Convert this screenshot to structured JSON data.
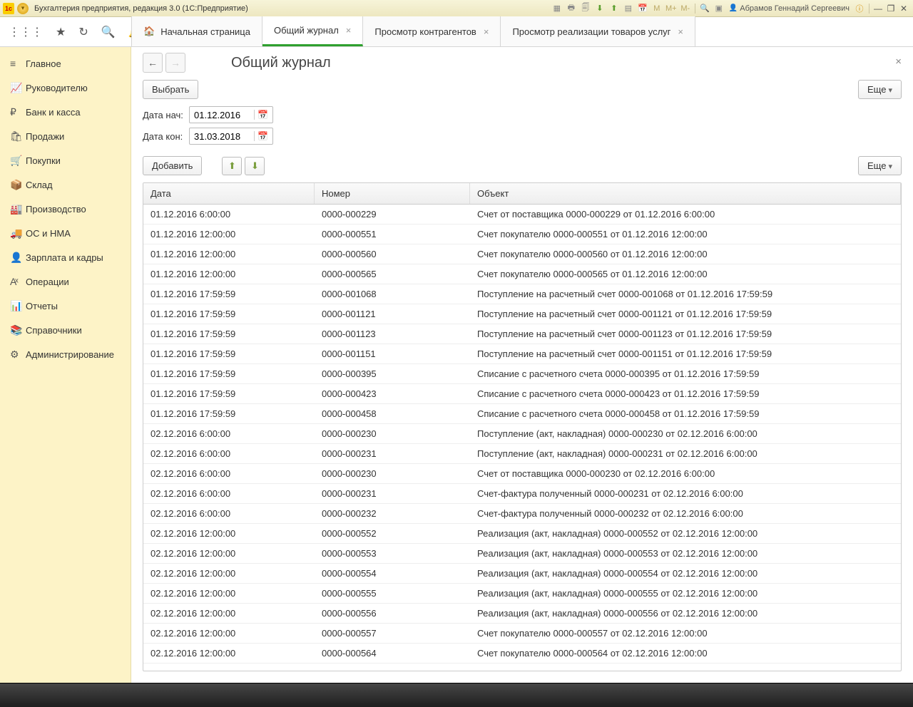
{
  "window": {
    "title": "Бухгалтерия предприятия, редакция 3.0  (1С:Предприятие)",
    "user": "Абрамов Геннадий Сергеевич"
  },
  "tabs": [
    {
      "label": "Начальная страница",
      "home": true,
      "closable": false,
      "active": false
    },
    {
      "label": "Общий журнал",
      "closable": true,
      "active": true
    },
    {
      "label": "Просмотр контрагентов",
      "closable": true,
      "active": false
    },
    {
      "label": "Просмотр реализации товаров услуг",
      "closable": true,
      "active": false
    }
  ],
  "sidebar": [
    {
      "icon": "≡",
      "label": "Главное"
    },
    {
      "icon": "📈",
      "label": "Руководителю"
    },
    {
      "icon": "₽",
      "label": "Банк и касса"
    },
    {
      "icon": "🛍",
      "label": "Продажи"
    },
    {
      "icon": "🛒",
      "label": "Покупки"
    },
    {
      "icon": "📦",
      "label": "Склад"
    },
    {
      "icon": "🏭",
      "label": "Производство"
    },
    {
      "icon": "🚚",
      "label": "ОС и НМА"
    },
    {
      "icon": "👤",
      "label": "Зарплата и кадры"
    },
    {
      "icon": "Аͯ",
      "label": "Операции"
    },
    {
      "icon": "📊",
      "label": "Отчеты"
    },
    {
      "icon": "📚",
      "label": "Справочники"
    },
    {
      "icon": "⚙",
      "label": "Администрирование"
    }
  ],
  "page": {
    "title": "Общий журнал",
    "select_btn": "Выбрать",
    "more_btn": "Еще",
    "date_from_label": "Дата нач:",
    "date_to_label": "Дата кон:",
    "date_from": "01.12.2016",
    "date_to": "31.03.2018",
    "add_btn": "Добавить"
  },
  "grid": {
    "columns": [
      "Дата",
      "Номер",
      "Объект"
    ],
    "rows": [
      {
        "d": "01.12.2016 6:00:00",
        "n": "0000-000229",
        "o": "Счет от поставщика 0000-000229 от 01.12.2016 6:00:00"
      },
      {
        "d": "01.12.2016 12:00:00",
        "n": "0000-000551",
        "o": "Счет покупателю 0000-000551 от 01.12.2016 12:00:00"
      },
      {
        "d": "01.12.2016 12:00:00",
        "n": "0000-000560",
        "o": "Счет покупателю 0000-000560 от 01.12.2016 12:00:00"
      },
      {
        "d": "01.12.2016 12:00:00",
        "n": "0000-000565",
        "o": "Счет покупателю 0000-000565 от 01.12.2016 12:00:00"
      },
      {
        "d": "01.12.2016 17:59:59",
        "n": "0000-001068",
        "o": "Поступление на расчетный счет 0000-001068 от 01.12.2016 17:59:59"
      },
      {
        "d": "01.12.2016 17:59:59",
        "n": "0000-001121",
        "o": "Поступление на расчетный счет 0000-001121 от 01.12.2016 17:59:59"
      },
      {
        "d": "01.12.2016 17:59:59",
        "n": "0000-001123",
        "o": "Поступление на расчетный счет 0000-001123 от 01.12.2016 17:59:59"
      },
      {
        "d": "01.12.2016 17:59:59",
        "n": "0000-001151",
        "o": "Поступление на расчетный счет 0000-001151 от 01.12.2016 17:59:59"
      },
      {
        "d": "01.12.2016 17:59:59",
        "n": "0000-000395",
        "o": "Списание с расчетного счета 0000-000395 от 01.12.2016 17:59:59"
      },
      {
        "d": "01.12.2016 17:59:59",
        "n": "0000-000423",
        "o": "Списание с расчетного счета 0000-000423 от 01.12.2016 17:59:59"
      },
      {
        "d": "01.12.2016 17:59:59",
        "n": "0000-000458",
        "o": "Списание с расчетного счета 0000-000458 от 01.12.2016 17:59:59"
      },
      {
        "d": "02.12.2016 6:00:00",
        "n": "0000-000230",
        "o": "Поступление (акт, накладная) 0000-000230 от 02.12.2016 6:00:00"
      },
      {
        "d": "02.12.2016 6:00:00",
        "n": "0000-000231",
        "o": "Поступление (акт, накладная) 0000-000231 от 02.12.2016 6:00:00"
      },
      {
        "d": "02.12.2016 6:00:00",
        "n": "0000-000230",
        "o": "Счет от поставщика 0000-000230 от 02.12.2016 6:00:00"
      },
      {
        "d": "02.12.2016 6:00:00",
        "n": "0000-000231",
        "o": "Счет-фактура полученный 0000-000231 от 02.12.2016 6:00:00"
      },
      {
        "d": "02.12.2016 6:00:00",
        "n": "0000-000232",
        "o": "Счет-фактура полученный 0000-000232 от 02.12.2016 6:00:00"
      },
      {
        "d": "02.12.2016 12:00:00",
        "n": "0000-000552",
        "o": "Реализация (акт, накладная) 0000-000552 от 02.12.2016 12:00:00"
      },
      {
        "d": "02.12.2016 12:00:00",
        "n": "0000-000553",
        "o": "Реализация (акт, накладная) 0000-000553 от 02.12.2016 12:00:00"
      },
      {
        "d": "02.12.2016 12:00:00",
        "n": "0000-000554",
        "o": "Реализация (акт, накладная) 0000-000554 от 02.12.2016 12:00:00"
      },
      {
        "d": "02.12.2016 12:00:00",
        "n": "0000-000555",
        "o": "Реализация (акт, накладная) 0000-000555 от 02.12.2016 12:00:00"
      },
      {
        "d": "02.12.2016 12:00:00",
        "n": "0000-000556",
        "o": "Реализация (акт, накладная) 0000-000556 от 02.12.2016 12:00:00"
      },
      {
        "d": "02.12.2016 12:00:00",
        "n": "0000-000557",
        "o": "Счет покупателю 0000-000557 от 02.12.2016 12:00:00"
      },
      {
        "d": "02.12.2016 12:00:00",
        "n": "0000-000564",
        "o": "Счет покупателю 0000-000564 от 02.12.2016 12:00:00"
      }
    ]
  }
}
